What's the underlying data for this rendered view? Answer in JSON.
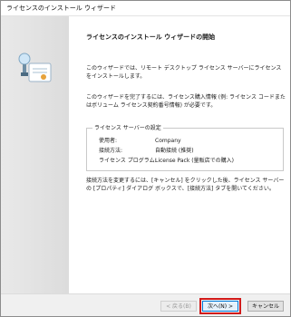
{
  "window": {
    "title": "ライセンスのインストール ウィザード"
  },
  "content": {
    "heading": "ライセンスのインストール ウィザードの開始",
    "paragraph1": "このウィザードでは、リモート デスクトップ ライセンス サーバーにライセンスをインストールします。",
    "paragraph2": "このウィザードを完了するには、ライセンス購入情報 (例: ライセンス コードまたはボリューム ライセンス契約番号情報) が必要です。",
    "settings": {
      "title": "ライセンス サーバーの設定",
      "rows": [
        {
          "label": "使用者:",
          "value": "Company"
        },
        {
          "label": "接続方法:",
          "value": "自動接続 (推奨)"
        },
        {
          "label": "ライセンス プログラム:",
          "value": "License Pack (量販店での購入)"
        }
      ]
    },
    "paragraph3": "接続方法を変更するには、[キャンセル] をクリックした後、ライセンス サーバーの [プロパティ] ダイアログ ボックスで、[接続方法] タブを開いてください。"
  },
  "buttons": {
    "back": "< 戻る(B)",
    "next": "次へ(N) >",
    "cancel": "キャンセル"
  },
  "icons": {
    "wizard": "license-certificate-icon"
  },
  "colors": {
    "highlight": "#d11a1a",
    "default_button_border": "#0078d7"
  }
}
